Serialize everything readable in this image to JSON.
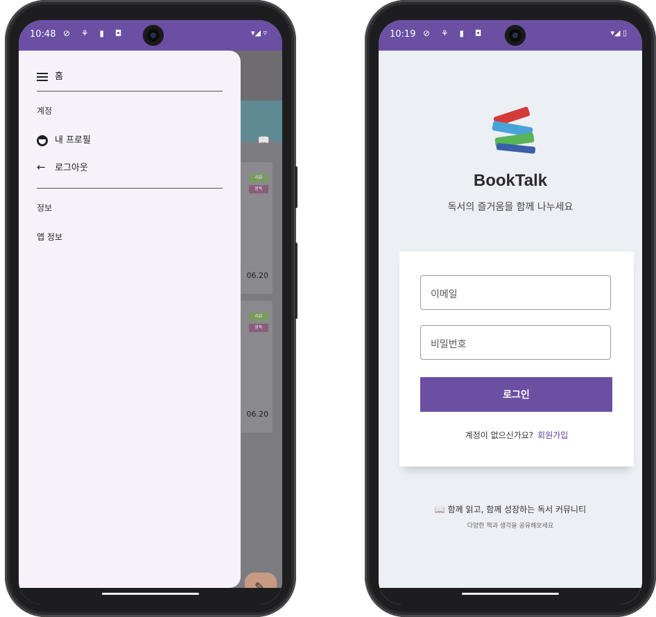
{
  "left_phone": {
    "status": {
      "time": "10:48",
      "icons": "⊘ ⚘ ▮ ◘",
      "right": "▾◢ ▿"
    },
    "drawer": {
      "home_label": "홈",
      "account_section": "계정",
      "profile_label": "내 프로필",
      "logout_label": "로그아웃",
      "info_section": "정보",
      "app_info_label": "앱 정보"
    },
    "background": {
      "tag1": "리뷰",
      "tag2": "완독",
      "tag3": "리뷰",
      "tag4": "완독",
      "date1": "06.20",
      "date2": "06.20"
    }
  },
  "right_phone": {
    "status": {
      "time": "10:19",
      "icons": "⊘ ⚘ ▮ ◘",
      "right": "▾◢ ▯"
    },
    "app_title": "BookTalk",
    "app_subtitle": "독서의 즐거움을 함께 나누세요",
    "email_placeholder": "이메일",
    "password_placeholder": "비밀번호",
    "login_button": "로그인",
    "signup_prompt": "계정이 없으신가요?",
    "signup_link": "회원가입",
    "community_text": "📖 함께 읽고, 함께 성장하는 독서 커뮤니티",
    "community_sub": "다양한 책과 생각을 공유해보세요"
  },
  "colors": {
    "primary": "#6a4fa3",
    "drawer_bg": "#f7f1f9",
    "login_bg": "#eceff4"
  }
}
